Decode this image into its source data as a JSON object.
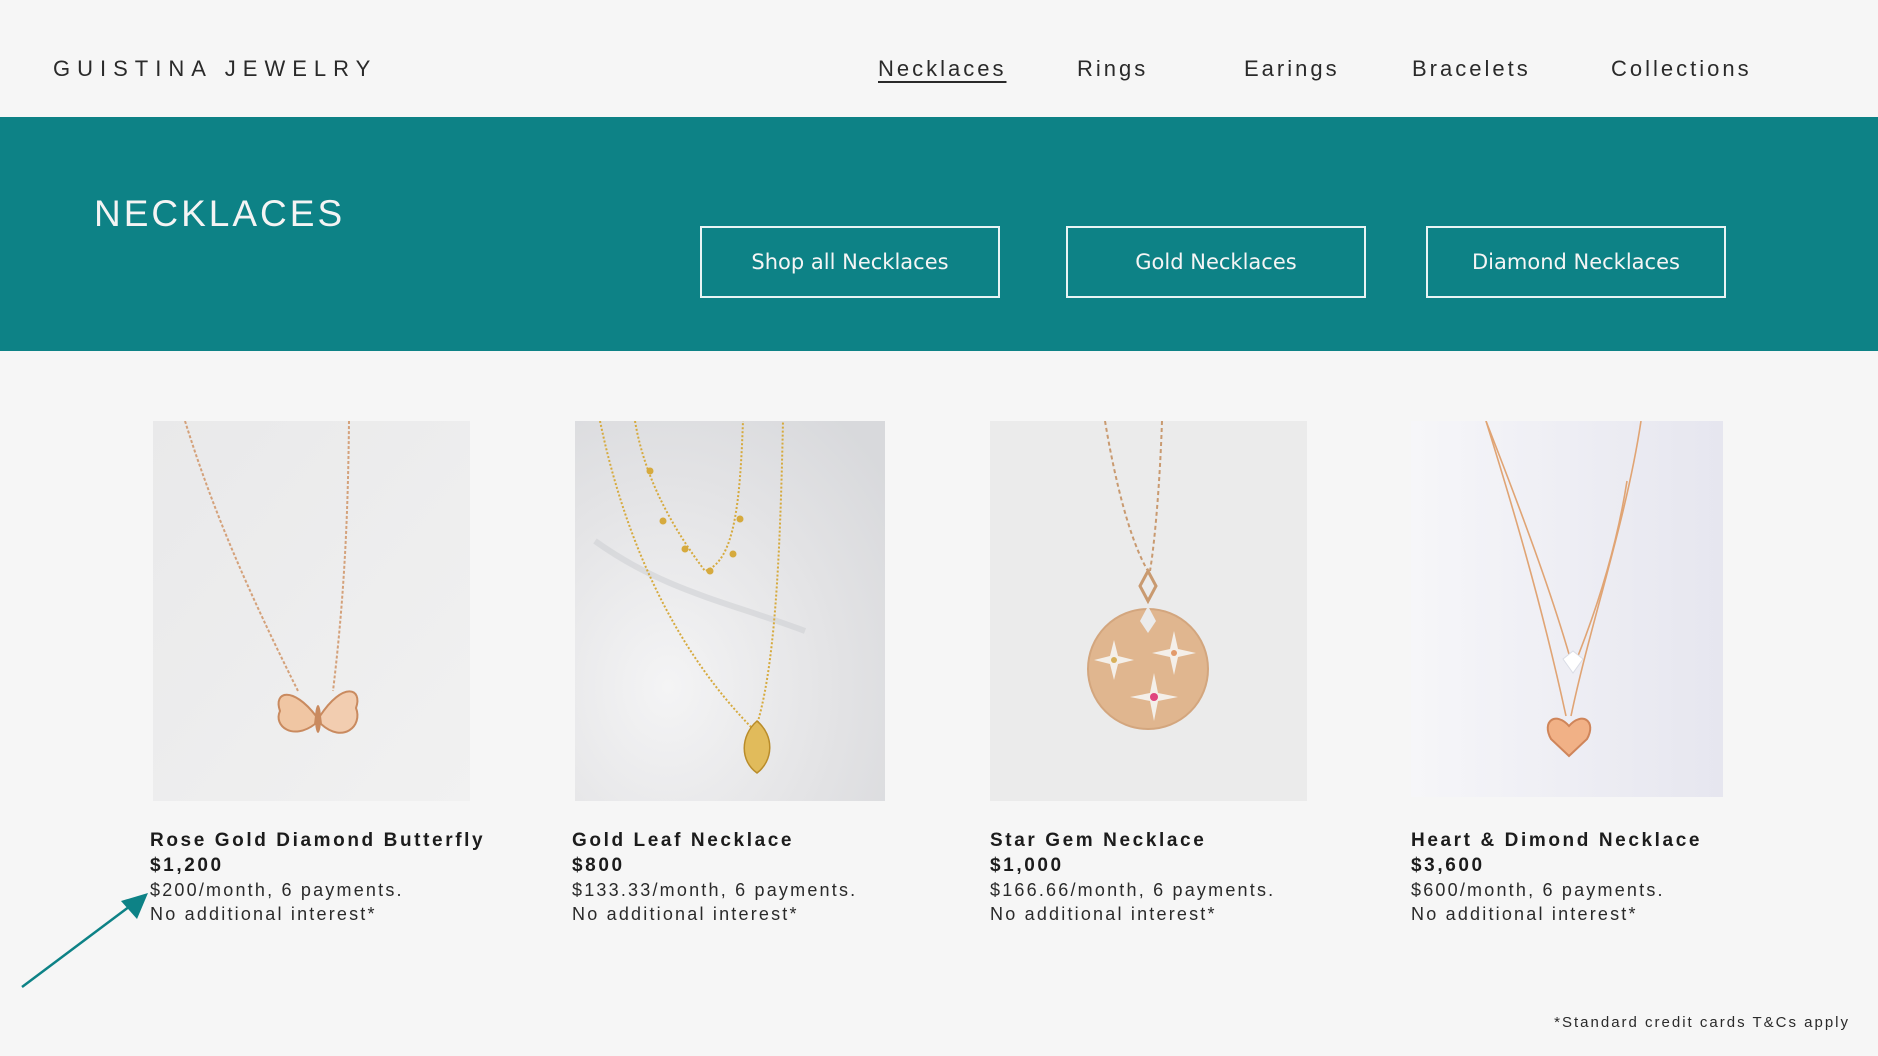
{
  "header": {
    "brand": "GUISTINA JEWELRY",
    "nav": [
      {
        "label": "Necklaces",
        "active": true
      },
      {
        "label": "Rings",
        "active": false
      },
      {
        "label": "Earings",
        "active": false
      },
      {
        "label": "Bracelets",
        "active": false
      },
      {
        "label": "Collections",
        "active": false
      }
    ]
  },
  "banner": {
    "title": "NECKLACES",
    "buttons": [
      "Shop all Necklaces",
      "Gold Necklaces",
      "Diamond Necklaces"
    ],
    "color": "#0d8286"
  },
  "products": [
    {
      "name": "Rose Gold Diamond Butterfly",
      "price": "$1,200",
      "plan": "$200/month, 6 payments.",
      "note": "No additional interest*",
      "image": "butterfly-necklace"
    },
    {
      "name": "Gold Leaf Necklace",
      "price": "$800",
      "plan": "$133.33/month, 6 payments.",
      "note": "No additional interest*",
      "image": "leaf-necklace"
    },
    {
      "name": "Star Gem Necklace",
      "price": "$1,000",
      "plan": "$166.66/month, 6 payments.",
      "note": "No additional interest*",
      "image": "star-gem-necklace"
    },
    {
      "name": "Heart & Dimond Necklace",
      "price": "$3,600",
      "plan": "$600/month, 6 payments.",
      "note": "No additional interest*",
      "image": "heart-diamond-necklace"
    }
  ],
  "footnote": "*Standard credit cards T&Cs apply",
  "annotation": {
    "icon": "arrow-icon",
    "color": "#0d8286"
  }
}
